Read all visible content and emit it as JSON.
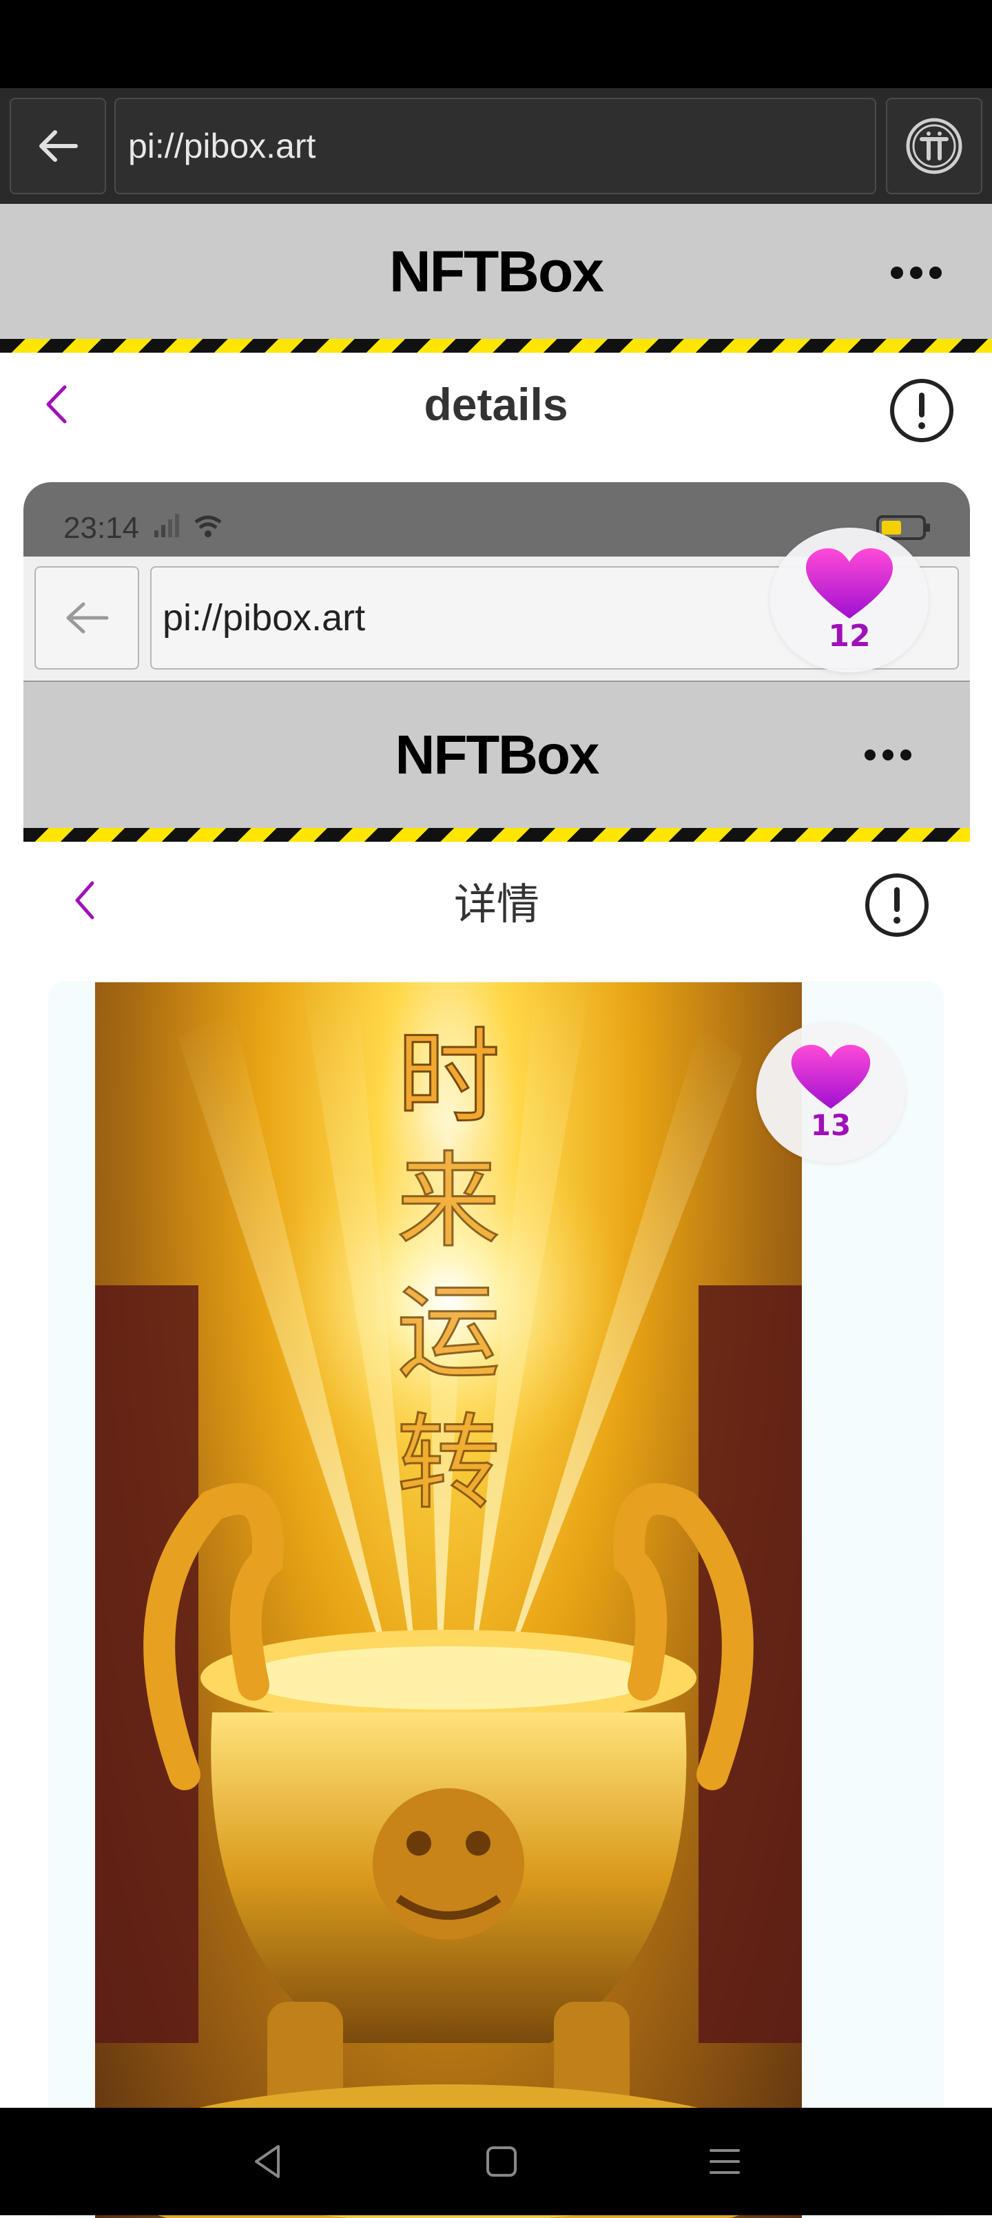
{
  "browser": {
    "url": "pi://pibox.art"
  },
  "app": {
    "title": "NFTBox"
  },
  "page": {
    "title": "details"
  },
  "inner_screenshot": {
    "status_time": "23:14",
    "browser_url": "pi://pibox.art",
    "app_title": "NFTBox",
    "page_title": "详情",
    "artwork_text": "时来运转"
  },
  "likes": {
    "outer_count": "12",
    "inner_count": "13"
  },
  "colors": {
    "accent": "#a010b8",
    "hazard_yellow": "#ffe600",
    "header_gray": "#cbcbcb",
    "heart_gradient_top": "#ff4ad8",
    "heart_gradient_bottom": "#a010d0"
  },
  "icons": {
    "outer_back": "arrow-left-icon",
    "pi_logo": "pi-logo-icon",
    "more": "more-horizontal-icon",
    "page_back": "chevron-left-icon",
    "info": "info-circle-icon",
    "heart": "heart-icon",
    "nav_back": "triangle-back-icon",
    "nav_home": "square-home-icon",
    "nav_menu": "menu-icon"
  }
}
